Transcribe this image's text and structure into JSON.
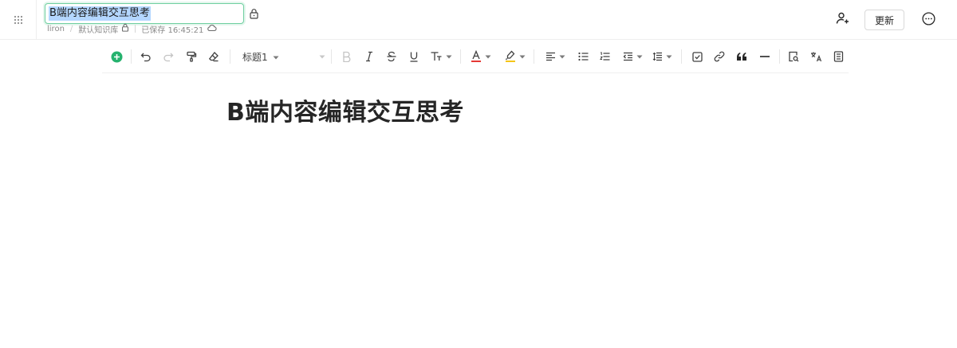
{
  "header": {
    "document_title": "B端内容编辑交互思考",
    "meta": {
      "author": "liron",
      "breadcrumb_separator": "/",
      "knowledge_base": "默认知识库",
      "saved_status": "已保存 16:45:21"
    },
    "update_label": "更新"
  },
  "toolbar": {
    "heading_value": "标题1"
  },
  "document": {
    "title": "B端内容编辑交互思考"
  },
  "colors": {
    "accent_green": "#25b26e",
    "title_border": "#6fcfa0",
    "selection": "#b4d7ff",
    "font_color_underline": "#e53935",
    "highlight_underline": "#f5c518"
  },
  "icons": [
    "apps-grid-icon",
    "lock-icon",
    "cloud-icon",
    "add-collaborator-icon",
    "more-icon",
    "insert-plus-icon",
    "undo-icon",
    "redo-icon",
    "format-painter-icon",
    "clear-format-icon",
    "bold-icon",
    "italic-icon",
    "strikethrough-icon",
    "underline-icon",
    "text-size-icon",
    "font-color-icon",
    "highlight-icon",
    "align-left-icon",
    "bullet-list-icon",
    "numbered-list-icon",
    "indent-icon",
    "line-height-icon",
    "checkbox-icon",
    "link-icon",
    "quote-icon",
    "divider-icon",
    "search-doc-icon",
    "translate-icon",
    "template-icon"
  ]
}
